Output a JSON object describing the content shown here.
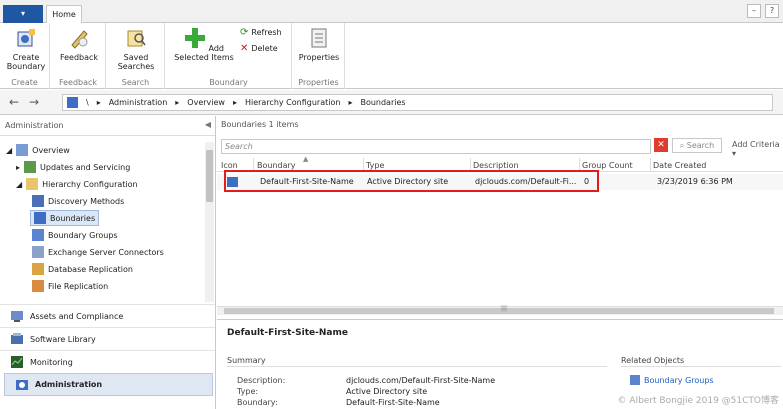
{
  "app_menu_label": "▾",
  "ribbon": {
    "tab_home": "Home",
    "groups": {
      "create": {
        "label": "Create",
        "button": "Create Boundary"
      },
      "feedback": {
        "label": "Feedback",
        "button": "Feedback"
      },
      "search": {
        "label": "Search",
        "button": "Saved Searches"
      },
      "boundary": {
        "label": "Boundary",
        "add_button": "Add Selected Items",
        "refresh": "Refresh",
        "delete": "Delete"
      },
      "properties": {
        "label": "Properties",
        "button": "Properties"
      }
    }
  },
  "address": {
    "back": "←",
    "forward": "→",
    "root": "\\",
    "crumbs": [
      "Administration",
      "Overview",
      "Hierarchy Configuration",
      "Boundaries"
    ]
  },
  "nav": {
    "title": "Administration",
    "collapse": "◀",
    "tree": {
      "overview": "Overview",
      "updates": "Updates and Servicing",
      "hierarchy": "Hierarchy Configuration",
      "discovery": "Discovery Methods",
      "boundaries": "Boundaries",
      "boundary_groups": "Boundary Groups",
      "exchange": "Exchange Server Connectors",
      "db_replication": "Database Replication",
      "file_replication": "File Replication"
    },
    "workspaces": [
      "Assets and Compliance",
      "Software Library",
      "Monitoring",
      "Administration"
    ]
  },
  "list": {
    "title": "Boundaries 1 items",
    "search_placeholder": "Search",
    "search_clear": "✕",
    "search_button": "Search",
    "add_criteria": "Add Criteria ▾",
    "columns": [
      "Icon",
      "Boundary",
      "Type",
      "Description",
      "Group Count",
      "Date Created"
    ],
    "rows": [
      {
        "boundary": "Default-First-Site-Name",
        "type": "Active Directory site",
        "description": "djclouds.com/Default-Fi...",
        "group_count": "0",
        "date_created": "3/23/2019 6:36 PM"
      }
    ],
    "scroll_grip": "|||"
  },
  "details": {
    "title": "Default-First-Site-Name",
    "summary_label": "Summary",
    "related_label": "Related Objects",
    "related_link": "Boundary Groups",
    "fields": [
      {
        "key": "Description:",
        "value": "djclouds.com/Default-First-Site-Name"
      },
      {
        "key": "Type:",
        "value": "Active Directory site"
      },
      {
        "key": "Boundary:",
        "value": "Default-First-Site-Name"
      }
    ]
  },
  "watermark": "© Albert Bongjie 2019 @51CTO博客",
  "colors": {
    "accent": "#1f57a3",
    "highlight": "#e31b1b",
    "selection": "#dbe7f7",
    "link": "#1f5fbf"
  }
}
